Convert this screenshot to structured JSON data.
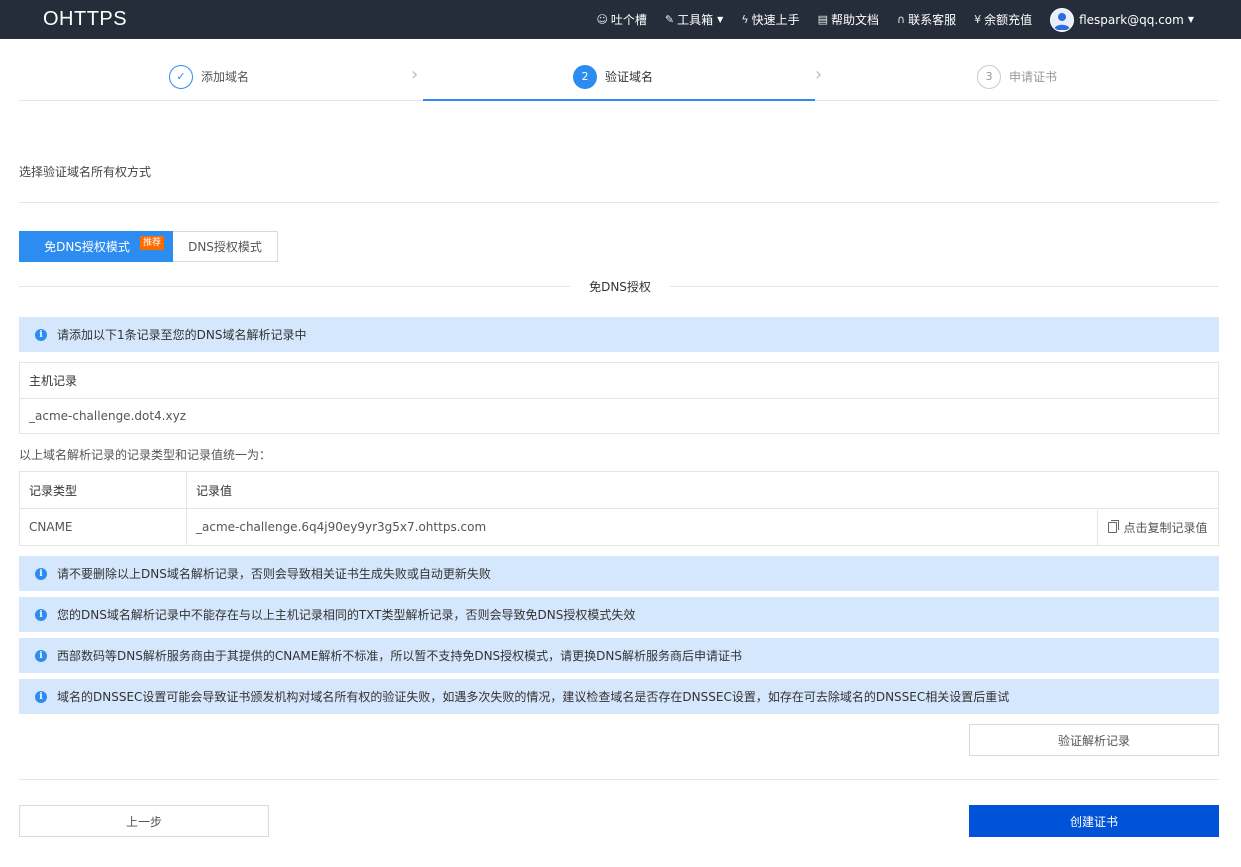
{
  "topbar": {
    "logo": "OHTTPS",
    "nav": [
      {
        "label": "吐个槽",
        "icon": "smile-icon"
      },
      {
        "label": "工具箱",
        "icon": "wrench-icon"
      },
      {
        "label": "快速上手",
        "icon": "lightning-icon"
      },
      {
        "label": "帮助文档",
        "icon": "document-icon"
      },
      {
        "label": "联系客服",
        "icon": "headset-icon"
      },
      {
        "label": "余额充值",
        "icon": "yen-icon"
      }
    ],
    "user": {
      "email": "flespark@qq.com"
    }
  },
  "steps": [
    {
      "label": "添加域名",
      "status": "done"
    },
    {
      "label": "验证域名",
      "number": "2",
      "status": "active"
    },
    {
      "label": "申请证书",
      "number": "3",
      "status": "pending"
    }
  ],
  "section_title": "选择验证域名所有权方式",
  "modes": {
    "active": "免DNS授权模式",
    "badge": "推荐",
    "inactive": "DNS授权模式"
  },
  "divider_label": "免DNS授权",
  "info_top": "请添加以下1条记录至您的DNS域名解析记录中",
  "host_record": {
    "header": "主机记录",
    "value": "_acme-challenge.dot4.xyz"
  },
  "record_desc": "以上域名解析记录的记录类型和记录值统一为：",
  "record_table": {
    "type_header": "记录类型",
    "value_header": "记录值",
    "type": "CNAME",
    "value": "_acme-challenge.6q4j90ey9yr3g5x7.ohttps.com",
    "copy_label": "点击复制记录值"
  },
  "notices": [
    "请不要删除以上DNS域名解析记录，否则会导致相关证书生成失败或自动更新失败",
    "您的DNS域名解析记录中不能存在与以上主机记录相同的TXT类型解析记录，否则会导致免DNS授权模式失效",
    "西部数码等DNS解析服务商由于其提供的CNAME解析不标准，所以暂不支持免DNS授权模式，请更换DNS解析服务商后申请证书",
    "域名的DNSSEC设置可能会导致证书颁发机构对域名所有权的验证失败，如遇多次失败的情况，建议检查域名是否存在DNSSEC设置，如存在可去除域名的DNSSEC相关设置后重试"
  ],
  "buttons": {
    "verify": "验证解析记录",
    "prev": "上一步",
    "create": "创建证书"
  },
  "colors": {
    "topbar": "#262d3a",
    "primary": "#2d8cf0",
    "create": "#0052d9",
    "info_bg": "#d5e7fc",
    "badge": "#ff6a00"
  }
}
